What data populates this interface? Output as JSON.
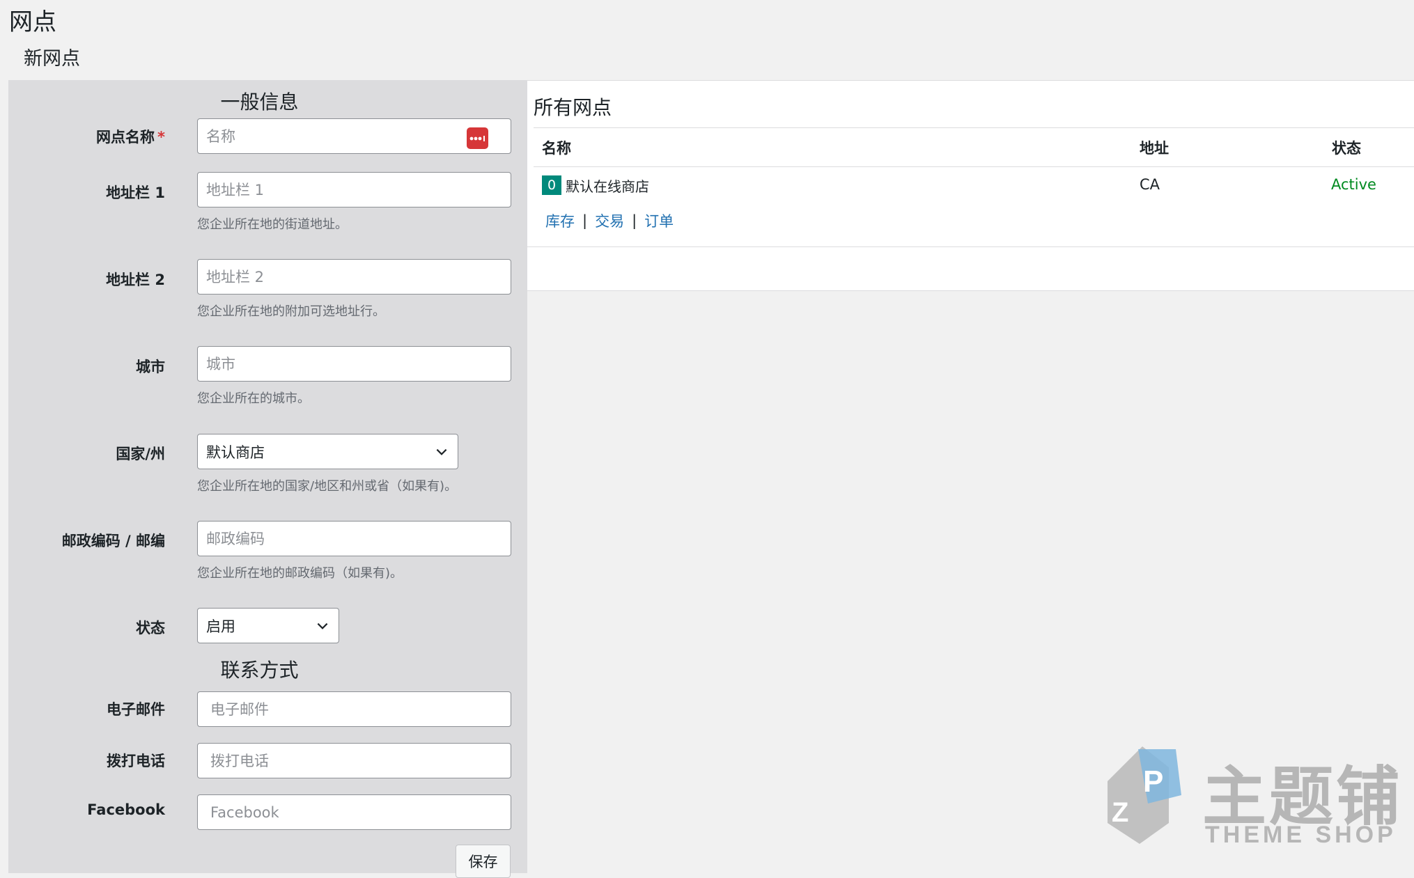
{
  "page": {
    "title": "网点",
    "subtitle": "新网点"
  },
  "form": {
    "general_heading": "一般信息",
    "contact_heading": "联系方式",
    "name": {
      "label": "网点名称",
      "required_mark": "*",
      "placeholder": "名称",
      "value": ""
    },
    "address1": {
      "label": "地址栏 1",
      "placeholder": "地址栏 1",
      "help": "您企业所在地的街道地址。"
    },
    "address2": {
      "label": "地址栏 2",
      "placeholder": "地址栏 2",
      "help": "您企业所在地的附加可选地址行。"
    },
    "city": {
      "label": "城市",
      "placeholder": "城市",
      "help": "您企业所在的城市。"
    },
    "country": {
      "label": "国家/州",
      "selected": "默认商店",
      "help": "您企业所在地的国家/地区和州或省（如果有)。"
    },
    "postcode": {
      "label": "邮政编码 / 邮编",
      "placeholder": "邮政编码",
      "help": "您企业所在地的邮政编码（如果有)。"
    },
    "status": {
      "label": "状态",
      "selected": "启用"
    },
    "email": {
      "label": "电子邮件",
      "placeholder": "电子邮件"
    },
    "phone": {
      "label": "拨打电话",
      "placeholder": "拨打电话"
    },
    "facebook": {
      "label": "Facebook",
      "placeholder": "Facebook"
    },
    "save_label": "保存"
  },
  "list": {
    "title": "所有网点",
    "columns": {
      "name": "名称",
      "address": "地址",
      "status": "状态"
    },
    "rows": [
      {
        "badge": "0",
        "name": "默认在线商店",
        "address": "CA",
        "status": "Active",
        "actions": [
          "库存",
          "交易",
          "订单"
        ],
        "action_separator": "|"
      }
    ]
  },
  "watermark": {
    "brand_cn": "主题铺",
    "brand_en": "THEME SHOP"
  },
  "colors": {
    "panel_bg": "#dcdcde",
    "page_bg": "#f1f1f1",
    "link": "#2271b1",
    "status_active": "#008a20",
    "badge": "#00897b",
    "password_icon": "#d63638"
  },
  "icons": {
    "password_manager": "password-dots-icon",
    "dropdown": "chevron-down-icon"
  }
}
